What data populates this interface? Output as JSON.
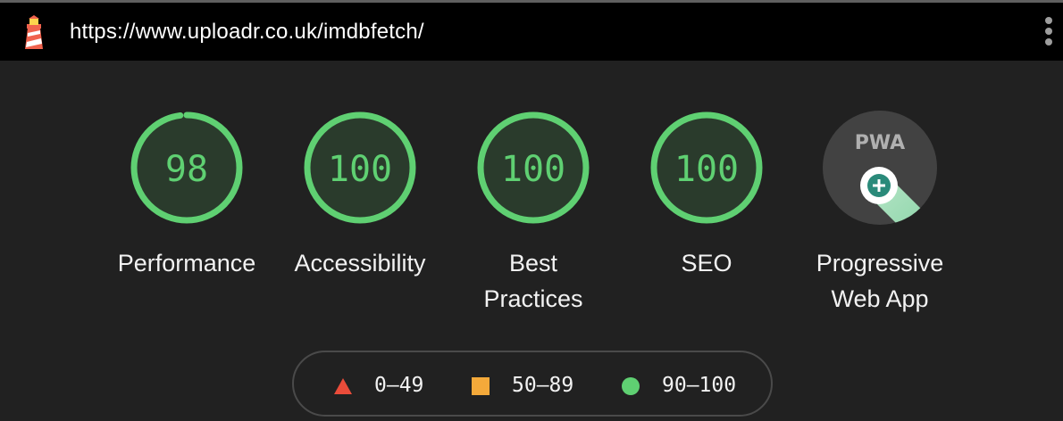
{
  "topbar": {
    "url": "https://www.uploadr.co.uk/imdbfetch/",
    "logo_icon": "lighthouse-icon",
    "menu_icon": "kebab-menu-icon"
  },
  "colors": {
    "pass": "#5fd072",
    "average": "#f4a93a",
    "fail": "#ea4c3a",
    "background": "#212121"
  },
  "categories": [
    {
      "label": "Performance",
      "score": "98",
      "fraction": 0.98
    },
    {
      "label": "Accessibility",
      "score": "100",
      "fraction": 1.0
    },
    {
      "label": "Best\nPractices",
      "score": "100",
      "fraction": 1.0
    },
    {
      "label": "SEO",
      "score": "100",
      "fraction": 1.0
    }
  ],
  "pwa": {
    "badge_text": "PWA",
    "label": "Progressive\nWeb App",
    "icon": "pwa-badge-icon"
  },
  "legend": {
    "fail": {
      "range": "0–49",
      "icon": "triangle-icon"
    },
    "average": {
      "range": "50–89",
      "icon": "square-icon"
    },
    "pass": {
      "range": "90–100",
      "icon": "circle-icon"
    }
  }
}
